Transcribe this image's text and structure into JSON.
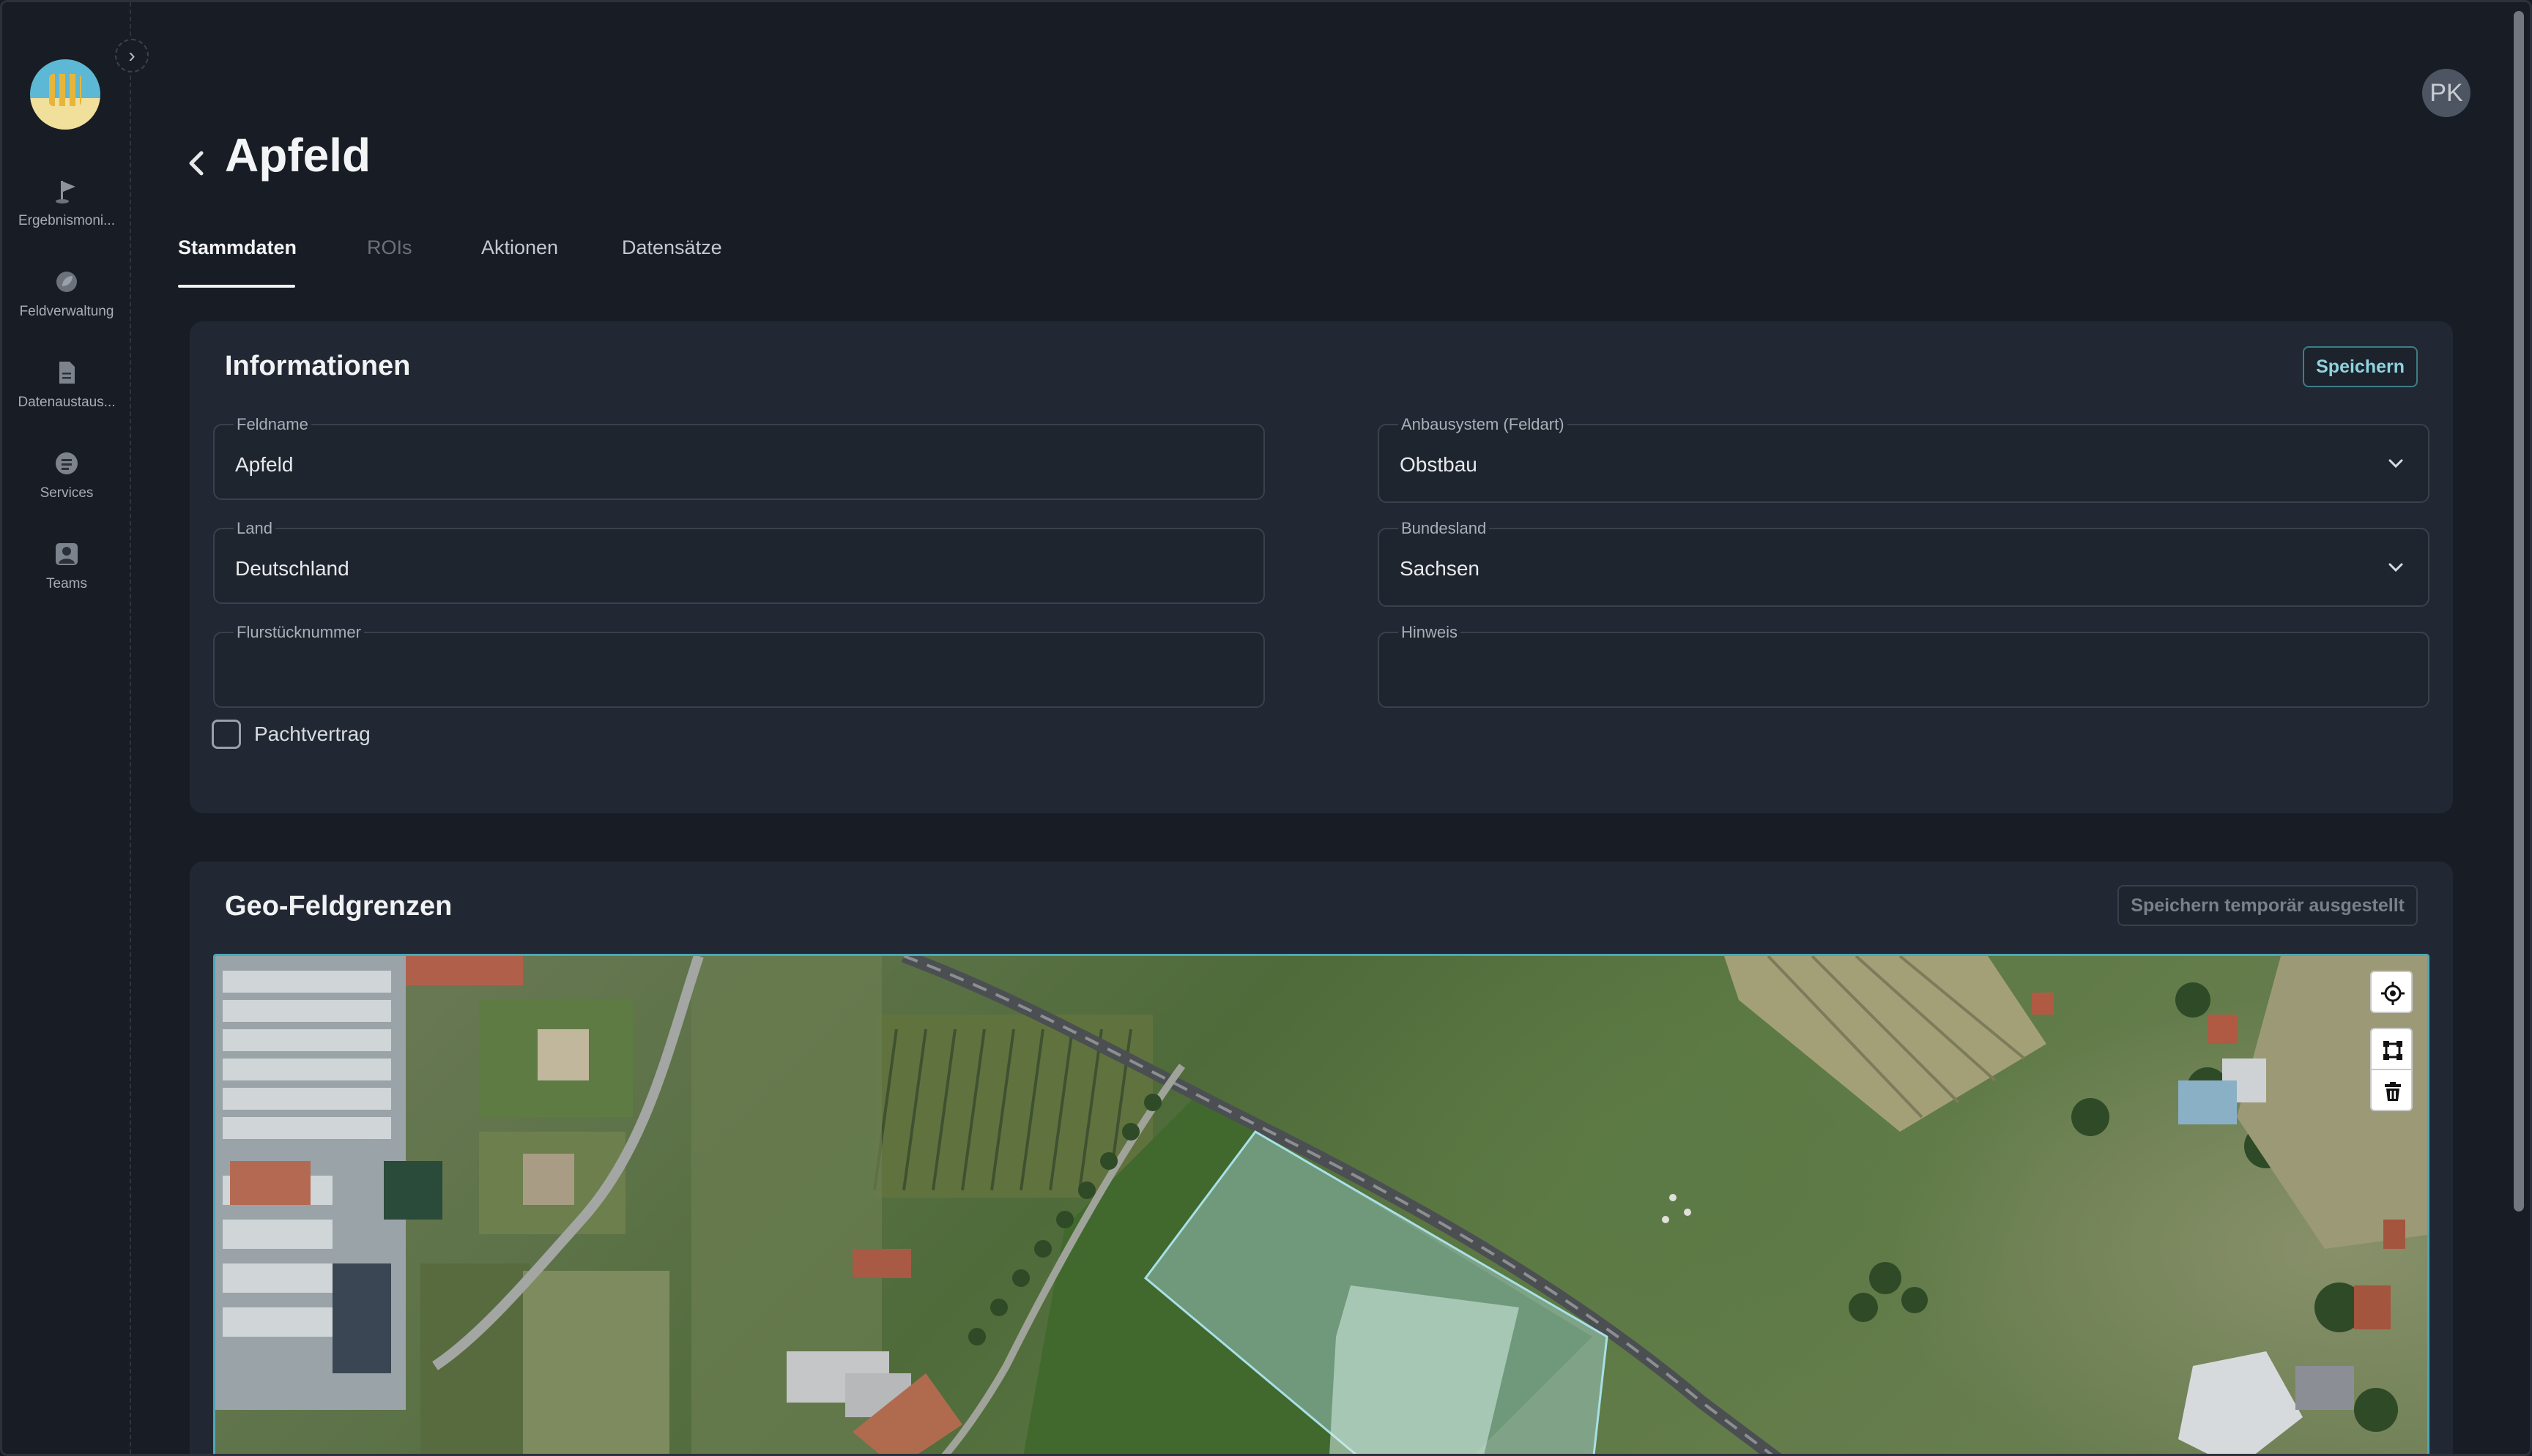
{
  "sidebar": {
    "collapse_icon": "chevron-right-icon",
    "items": [
      {
        "label": "Ergebnismoni...",
        "icon": "flag-icon"
      },
      {
        "label": "Feldverwaltung",
        "icon": "leaf-icon"
      },
      {
        "label": "Datenaustaus...",
        "icon": "document-icon"
      },
      {
        "label": "Services",
        "icon": "services-icon"
      },
      {
        "label": "Teams",
        "icon": "user-icon"
      }
    ]
  },
  "header": {
    "title": "Apfeld",
    "avatar_initials": "PK"
  },
  "tabs": [
    {
      "label": "Stammdaten",
      "state": "active"
    },
    {
      "label": "ROIs",
      "state": "disabled"
    },
    {
      "label": "Aktionen",
      "state": "normal"
    },
    {
      "label": "Datensätze",
      "state": "normal"
    }
  ],
  "informationen": {
    "title": "Informationen",
    "save_label": "Speichern",
    "fields": {
      "feldname": {
        "label": "Feldname",
        "value": "Apfeld"
      },
      "anbausystem": {
        "label": "Anbausystem (Feldart)",
        "value": "Obstbau"
      },
      "land": {
        "label": "Land",
        "value": "Deutschland"
      },
      "bundesland": {
        "label": "Bundesland",
        "value": "Sachsen"
      },
      "flurstuecknummer": {
        "label": "Flurstücknummer",
        "value": ""
      },
      "hinweis": {
        "label": "Hinweis",
        "value": ""
      }
    },
    "pachtvertrag": {
      "label": "Pachtvertrag",
      "checked": false
    }
  },
  "geo": {
    "title": "Geo-Feldgrenzen",
    "save_disabled_label": "Speichern temporär ausgestellt",
    "controls": [
      "locate-icon",
      "draw-polygon-icon",
      "trash-icon"
    ],
    "accent": "#4aa9b8"
  }
}
